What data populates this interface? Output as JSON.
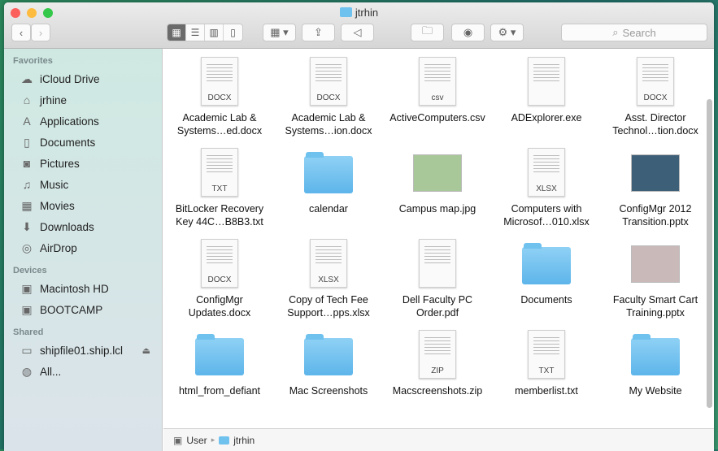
{
  "window": {
    "title": "jtrhin"
  },
  "toolbar": {
    "search_placeholder": "Search",
    "back": "‹",
    "forward": "›"
  },
  "sidebar": {
    "favorites_header": "Favorites",
    "favorites": [
      {
        "label": "iCloud Drive",
        "icon": "cloud-icon",
        "glyph": "☁"
      },
      {
        "label": "jrhine",
        "icon": "home-icon",
        "glyph": "⌂"
      },
      {
        "label": "Applications",
        "icon": "applications-icon",
        "glyph": "A"
      },
      {
        "label": "Documents",
        "icon": "documents-icon",
        "glyph": "▯"
      },
      {
        "label": "Pictures",
        "icon": "camera-icon",
        "glyph": "◙"
      },
      {
        "label": "Music",
        "icon": "music-icon",
        "glyph": "♫"
      },
      {
        "label": "Movies",
        "icon": "film-icon",
        "glyph": "▦"
      },
      {
        "label": "Downloads",
        "icon": "download-icon",
        "glyph": "⬇"
      },
      {
        "label": "AirDrop",
        "icon": "airdrop-icon",
        "glyph": "◎"
      }
    ],
    "devices_header": "Devices",
    "devices": [
      {
        "label": "Macintosh HD",
        "icon": "hard-drive-icon",
        "glyph": "▣"
      },
      {
        "label": "BOOTCAMP",
        "icon": "hard-drive-icon",
        "glyph": "▣"
      }
    ],
    "shared_header": "Shared",
    "shared": [
      {
        "label": "shipfile01.ship.lcl",
        "icon": "computer-icon",
        "glyph": "▭"
      },
      {
        "label": "All...",
        "icon": "network-icon",
        "glyph": "◍"
      }
    ],
    "eject": "⏏"
  },
  "files": [
    {
      "name": "Academic Lab & Systems…ed.docx",
      "type": "doc",
      "badge": "DOCX"
    },
    {
      "name": "Academic Lab & Systems…ion.docx",
      "type": "doc",
      "badge": "DOCX"
    },
    {
      "name": "ActiveComputers.csv",
      "type": "doc",
      "badge": "csv"
    },
    {
      "name": "ADExplorer.exe",
      "type": "doc",
      "badge": ""
    },
    {
      "name": "Asst. Director Technol…tion.docx",
      "type": "doc",
      "badge": "DOCX"
    },
    {
      "name": "BitLocker Recovery Key 44C…B8B3.txt",
      "type": "doc",
      "badge": "TXT"
    },
    {
      "name": "calendar",
      "type": "folder"
    },
    {
      "name": "Campus map.jpg",
      "type": "thumb",
      "color": "#a8c89a"
    },
    {
      "name": "Computers with Microsof…010.xlsx",
      "type": "doc",
      "badge": "XLSX"
    },
    {
      "name": "ConfigMgr 2012 Transition.pptx",
      "type": "thumb",
      "color": "#3d5f78"
    },
    {
      "name": "ConfigMgr Updates.docx",
      "type": "doc",
      "badge": "DOCX"
    },
    {
      "name": "Copy of Tech Fee Support…pps.xlsx",
      "type": "doc",
      "badge": "XLSX"
    },
    {
      "name": "Dell Faculty PC Order.pdf",
      "type": "doc",
      "badge": ""
    },
    {
      "name": "Documents",
      "type": "folder"
    },
    {
      "name": "Faculty Smart Cart Training.pptx",
      "type": "thumb",
      "color": "#c9b9b9"
    },
    {
      "name": "html_from_defiant",
      "type": "folder"
    },
    {
      "name": "Mac Screenshots",
      "type": "folder"
    },
    {
      "name": "Macscreenshots.zip",
      "type": "doc",
      "badge": "ZIP"
    },
    {
      "name": "memberlist.txt",
      "type": "doc",
      "badge": "TXT"
    },
    {
      "name": "My Website",
      "type": "folder"
    }
  ],
  "pathbar": {
    "items": [
      "User",
      "jtrhin"
    ],
    "separator": "▸"
  }
}
